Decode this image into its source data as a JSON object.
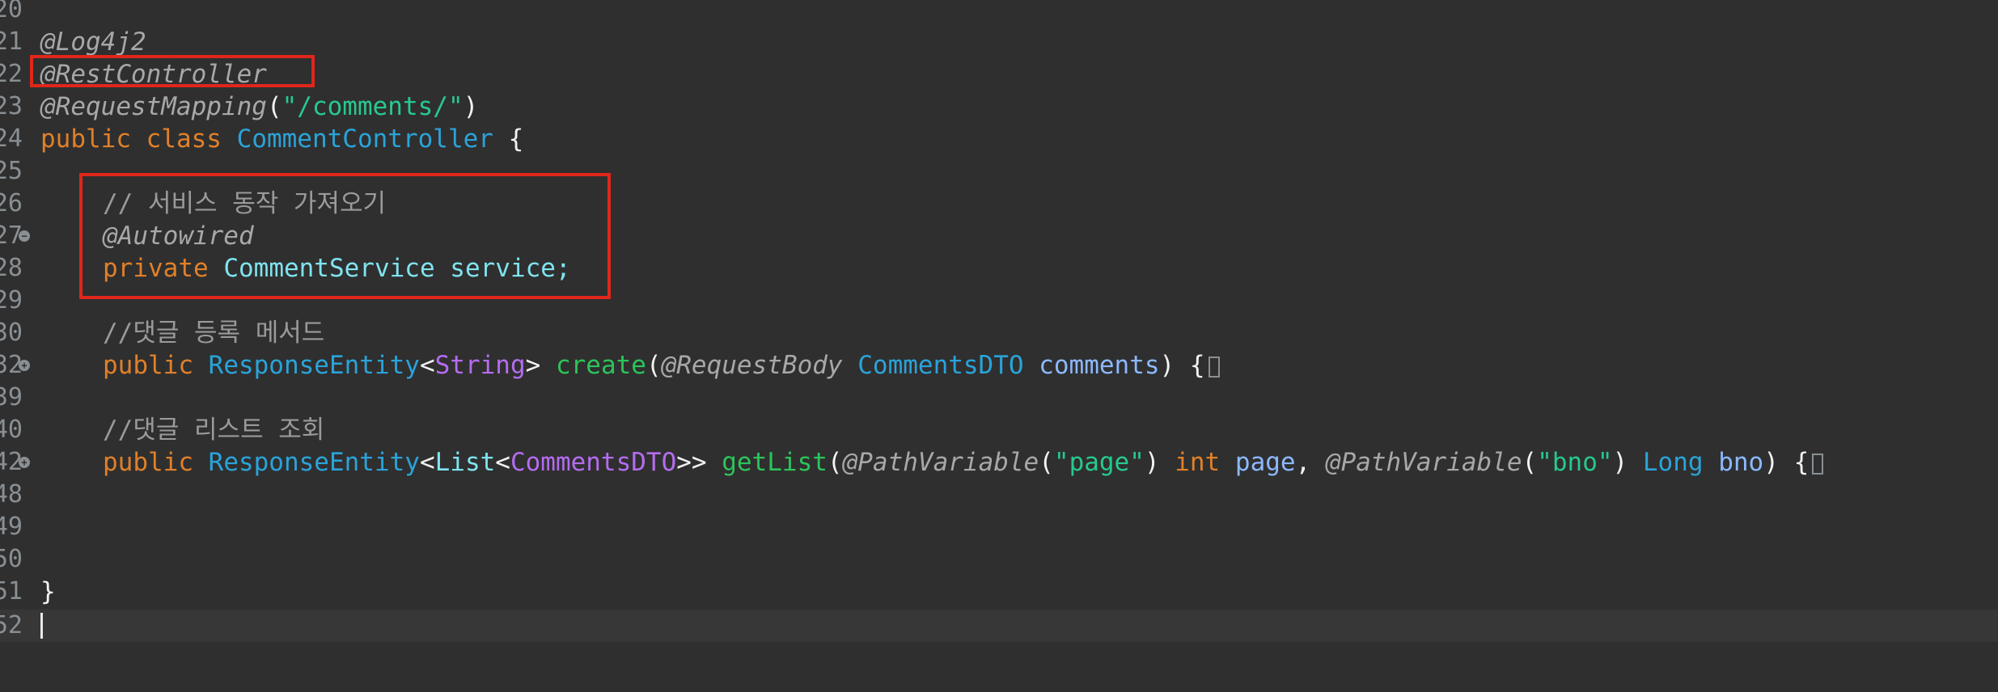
{
  "editor": {
    "lines": [
      {
        "num": "20"
      },
      {
        "num": "21",
        "ann": "@Log4j2"
      },
      {
        "num": "22",
        "ann": "@RestController"
      },
      {
        "num": "23",
        "ann": "@RequestMapping",
        "open": "(",
        "str": "\"/comments/\"",
        "close": ")"
      },
      {
        "num": "24",
        "kw1": "public",
        "kw2": "class",
        "cls": "CommentController",
        "brace": "{"
      },
      {
        "num": "25"
      },
      {
        "num": "26",
        "comment": "// 서비스 동작 가져오기"
      },
      {
        "num": "27",
        "ann": "@Autowired"
      },
      {
        "num": "28",
        "kw": "private",
        "type": "CommentService",
        "var": "service;"
      },
      {
        "num": "29"
      },
      {
        "num": "30",
        "comment": "//댓글 등록 메서드"
      },
      {
        "num": "32",
        "kw": "public",
        "cls": "ResponseEntity",
        "lt": "<",
        "generic": "String",
        "gt": ">",
        "method": "create",
        "open": "(",
        "ann": "@RequestBody",
        "ptype": "CommentsDTO",
        "pname": "comments",
        "close": ")",
        "brace": "{"
      },
      {
        "num": "39"
      },
      {
        "num": "40",
        "comment": "//댓글 리스트 조회"
      },
      {
        "num": "42",
        "kw": "public",
        "cls": "ResponseEntity",
        "lt1": "<",
        "list": "List",
        "lt2": "<",
        "generic": "CommentsDTO",
        "gt": ">>",
        "method": "getList",
        "open": "(",
        "ann1": "@PathVariable",
        "open1": "(",
        "str1": "\"page\"",
        "close1": ")",
        "kwint": "int",
        "p1": "page",
        "comma": ",",
        "ann2": "@PathVariable",
        "open2": "(",
        "str2": "\"bno\"",
        "close2": ")",
        "tlong": "Long",
        "p2": "bno",
        "close": ")",
        "brace": "{"
      },
      {
        "num": "48"
      },
      {
        "num": "49"
      },
      {
        "num": "50"
      },
      {
        "num": "51",
        "brace": "}"
      },
      {
        "num": "52"
      }
    ]
  },
  "colors": {
    "background": "#2f2f2f",
    "annotation": "#a8a8a8",
    "keyword": "#e0802a",
    "class": "#2aa3d9",
    "type": "#b46cf0",
    "string": "#27c98e",
    "method": "#2cc45a",
    "parameter": "#8cb8ff",
    "highlight": "#e0261b"
  }
}
